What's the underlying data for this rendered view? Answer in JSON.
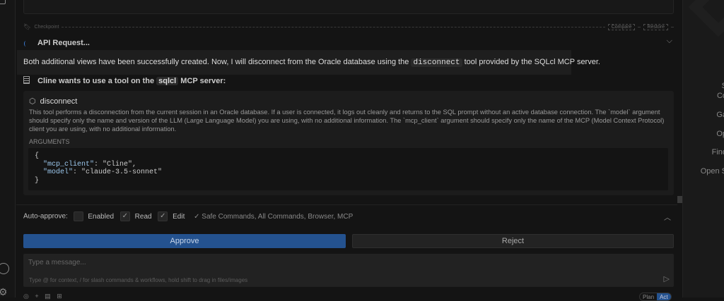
{
  "checkpoint": {
    "label": "Checkpoint",
    "compare": "Compare",
    "restore": "Restore"
  },
  "api_request": {
    "label": "API Request..."
  },
  "message": {
    "before": "Both additional views have been successfully created. Now, I will disconnect from the Oracle database using the",
    "code": "disconnect",
    "after": "tool provided by the SQLcl MCP server."
  },
  "tool_prompt": {
    "before": "Cline wants to use a tool on the",
    "server": "sqlcl",
    "after": "MCP server:"
  },
  "tool": {
    "name": "disconnect",
    "description": "This tool performs a disconnection from the current session in an Oracle database. If a user is connected, it logs out cleanly and returns to the SQL prompt without an active database connection. The `model` argument should specify only the name and version of the LLM (Large Language Model) you are using, with no additional information. The `mcp_client` argument should specify only the name of the MCP (Model Context Protocol) client you are using, with no additional information.",
    "arguments_label": "ARGUMENTS",
    "args": {
      "open": "{",
      "k1": "\"mcp_client\"",
      "v1": ": \"Cline\",",
      "k2": "\"model\"",
      "v2": ": \"claude-3.5-sonnet\"",
      "close": "}"
    }
  },
  "auto_approve": {
    "label": "Auto-approve:",
    "enabled": "Enabled",
    "read": "Read",
    "edit": "Edit",
    "extra": "✓ Safe Commands, All Commands, Browser, MCP"
  },
  "buttons": {
    "approve": "Approve",
    "reject": "Reject"
  },
  "input": {
    "placeholder": "Type a message...",
    "hint": "Type @ for context, / for slash commands & workflows, hold shift to drag in files/images"
  },
  "mode": {
    "plan": "Plan",
    "act": "Act"
  },
  "right_panel": [
    "S",
    "Co",
    "Ga",
    "Op",
    "Find",
    "Open S"
  ],
  "colors": {
    "accent": "#24528f"
  }
}
